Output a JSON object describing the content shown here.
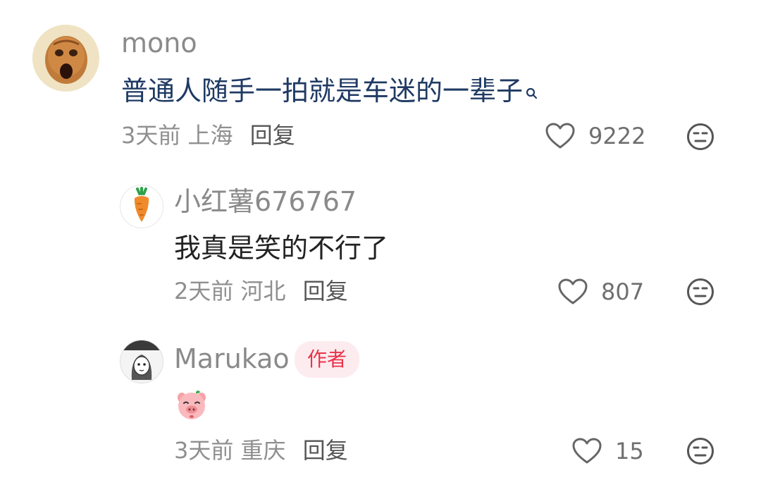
{
  "comments": [
    {
      "username": "mono",
      "text": "普通人随手一拍就是车迷的一辈子",
      "time": "3天前",
      "location": "上海",
      "reply_label": "回复",
      "likes": "9222",
      "text_color": "#1f3a63",
      "search_icon": "search-icon"
    },
    {
      "username": "小红薯676767",
      "text": "我真是笑的不行了",
      "time": "2天前",
      "location": "河北",
      "reply_label": "回复",
      "likes": "807"
    },
    {
      "username": "Marukao",
      "badge": "作者",
      "text_emoji": "pig-emoji",
      "time": "3天前",
      "location": "重庆",
      "reply_label": "回复",
      "likes": "15"
    }
  ],
  "colors": {
    "badge_bg": "#fdecef",
    "badge_text": "#e8334a",
    "meta_text": "#8f8f8f"
  }
}
